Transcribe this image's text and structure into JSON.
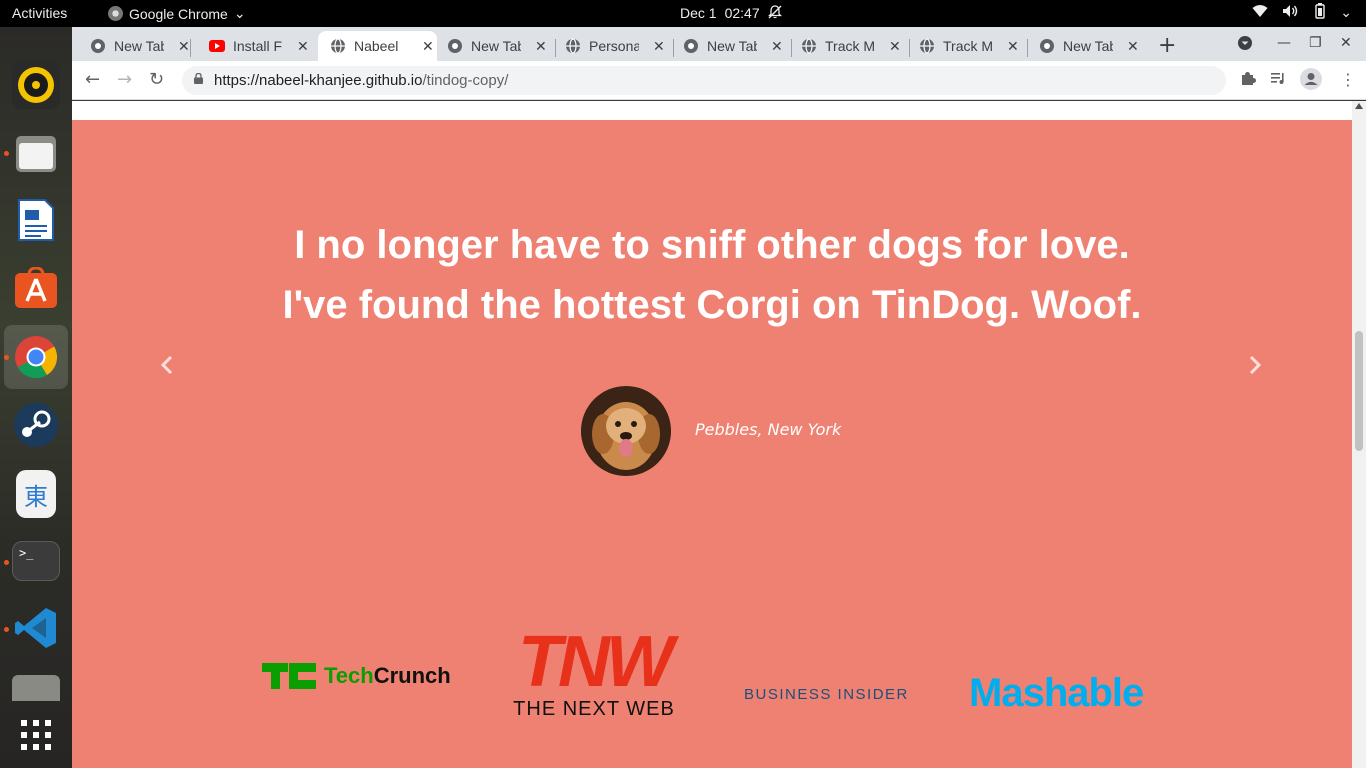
{
  "topbar": {
    "activities": "Activities",
    "app_name": "Google Chrome",
    "date": "Dec 1",
    "time": "02:47"
  },
  "dock": {
    "items": [
      "rhythmbox-icon",
      "files-icon",
      "writer-icon",
      "software-icon",
      "chrome-icon",
      "steam-icon",
      "mozc-icon",
      "terminal-icon",
      "vscode-icon",
      "archive-icon",
      "app-grid-icon"
    ],
    "mozc_glyph": "東",
    "terminal_glyph": ">_"
  },
  "tabs": [
    {
      "title": "New Tab",
      "favicon": "chrome"
    },
    {
      "title": "Install F",
      "favicon": "youtube"
    },
    {
      "title": "Nabeel",
      "favicon": "globe",
      "active": true
    },
    {
      "title": "New Tab",
      "favicon": "chrome"
    },
    {
      "title": "Personal",
      "favicon": "globe"
    },
    {
      "title": "New Tab",
      "favicon": "chrome"
    },
    {
      "title": "Track M",
      "favicon": "globe"
    },
    {
      "title": "Track M",
      "favicon": "globe"
    },
    {
      "title": "New Tab",
      "favicon": "chrome"
    }
  ],
  "toolbar": {
    "url_host": "https://nabeel-khanjee.github.io",
    "url_path": "/tindog-copy/"
  },
  "page": {
    "quote_line1": "I no longer have to sniff other dogs for love.",
    "quote_line2": "I've found the hottest Corgi on TinDog. Woof.",
    "author": "Pebbles, New York",
    "press": {
      "techcrunch_a": "Tech",
      "techcrunch_b": "Crunch",
      "tnw_big": "TNW",
      "tnw_small": "THE NEXT WEB",
      "business_insider": "BUSINESS INSIDER",
      "mashable": "Mashable"
    }
  },
  "colors": {
    "testimonial_bg": "#ef8172",
    "accent": "#e95420"
  }
}
